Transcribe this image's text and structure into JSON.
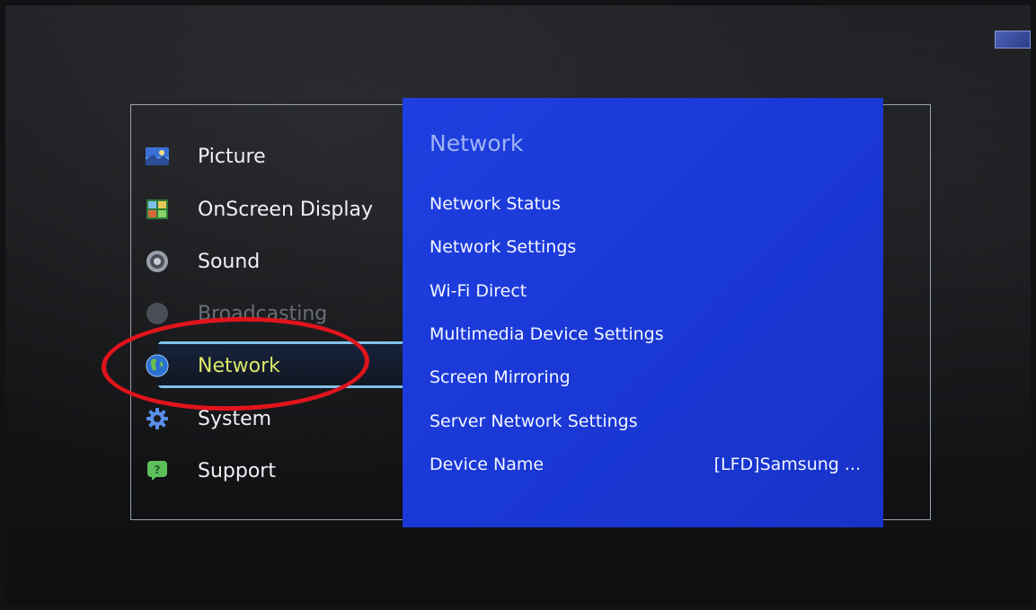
{
  "main_menu": {
    "items": [
      {
        "label": "Picture",
        "icon": "picture-icon"
      },
      {
        "label": "OnScreen Display",
        "icon": "onscreen-display-icon"
      },
      {
        "label": "Sound",
        "icon": "speaker-icon"
      },
      {
        "label": "Broadcasting",
        "icon": "broadcasting-icon"
      },
      {
        "label": "Network",
        "icon": "globe-icon"
      },
      {
        "label": "System",
        "icon": "gear-icon"
      },
      {
        "label": "Support",
        "icon": "help-icon"
      }
    ],
    "selected": "Network"
  },
  "submenu": {
    "title": "Network",
    "items": [
      {
        "label": "Network Status",
        "value": ""
      },
      {
        "label": "Network Settings",
        "value": ""
      },
      {
        "label": "Wi-Fi Direct",
        "value": ""
      },
      {
        "label": "Multimedia Device Settings",
        "value": ""
      },
      {
        "label": "Screen Mirroring",
        "value": ""
      },
      {
        "label": "Server Network Settings",
        "value": ""
      },
      {
        "label": "Device Name",
        "value": "[LFD]Samsung ..."
      }
    ]
  },
  "colors": {
    "submenu_bg": "#1f3fe0",
    "selected_text": "#dde86a",
    "annotation": "#e0141c"
  }
}
